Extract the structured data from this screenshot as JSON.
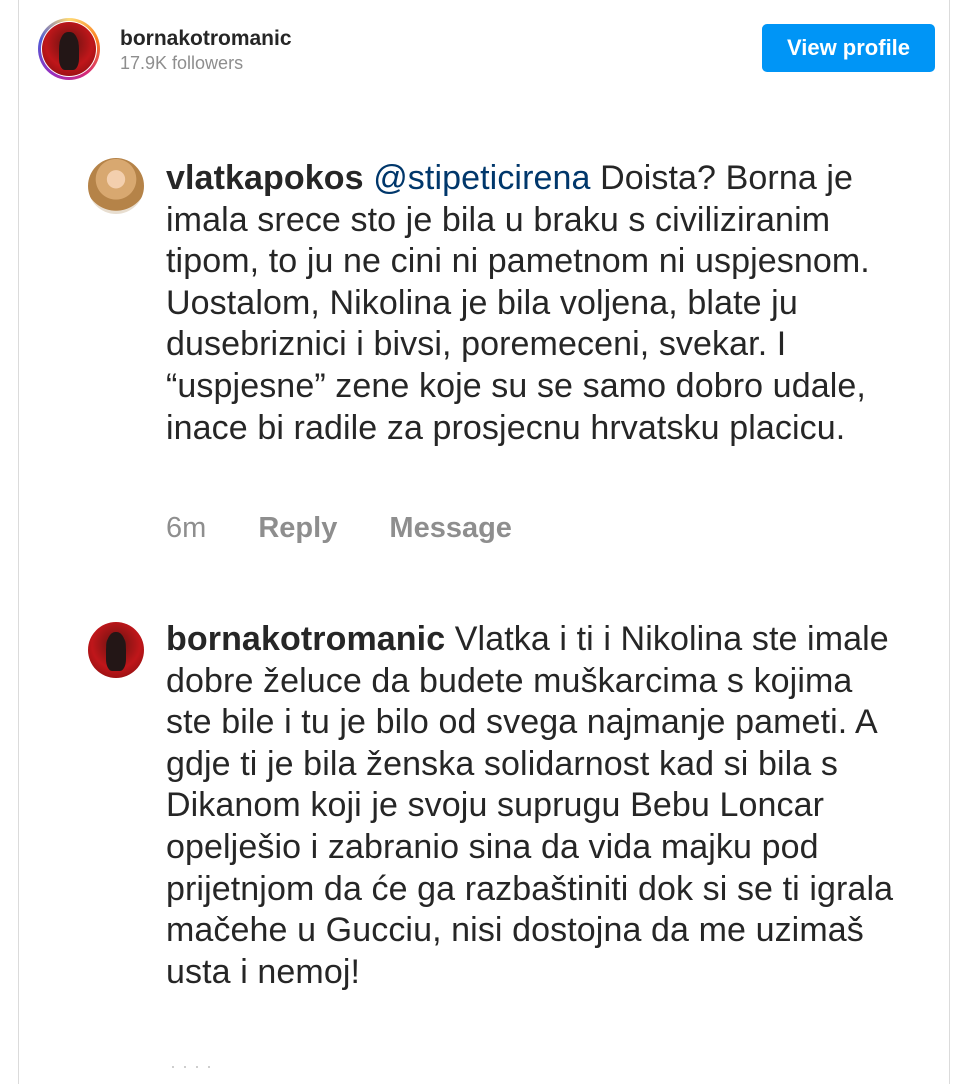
{
  "header": {
    "username": "bornakotromanic",
    "followers": "17.9K followers",
    "view_profile_label": "View profile"
  },
  "comments": [
    {
      "username": "vlatkapokos",
      "mention": "@stipeticirena",
      "text": " Doista? Borna je imala srece sto je bila u braku s civiliziranim tipom, to ju ne cini ni pametnom ni uspjesnom. Uostalom, Nikolina je bila voljena, blate ju dusebriznici i bivsi, poremeceni, svekar. I “uspjesne” zene koje su se samo dobro udale, inace bi radile za prosjecnu hrvatsku placicu.",
      "time": "6m",
      "reply_label": "Reply",
      "message_label": "Message"
    },
    {
      "username": "bornakotromanic",
      "text": " Vlatka i ti i Nikolina ste imale dobre želuce da budete muškarcima s kojima ste bile i tu je bilo od svega najmanje pameti. A gdje ti je bila ženska solidarnost kad si bila s Dikanom koji je svoju suprugu Bebu Loncar opelješio i zabranio sina da vida majku pod prijetnjom da će ga razbaštiniti dok si se ti igrala mačehe u Gucciu, nisi dostojna da me uzimaš usta i nemoj!"
    }
  ],
  "icons": {
    "profile_avatar": "avatar-icon",
    "comment_avatar": "avatar-icon"
  },
  "colors": {
    "button": "#0095f6",
    "mention": "#00376b",
    "muted": "#8e8e8e"
  }
}
